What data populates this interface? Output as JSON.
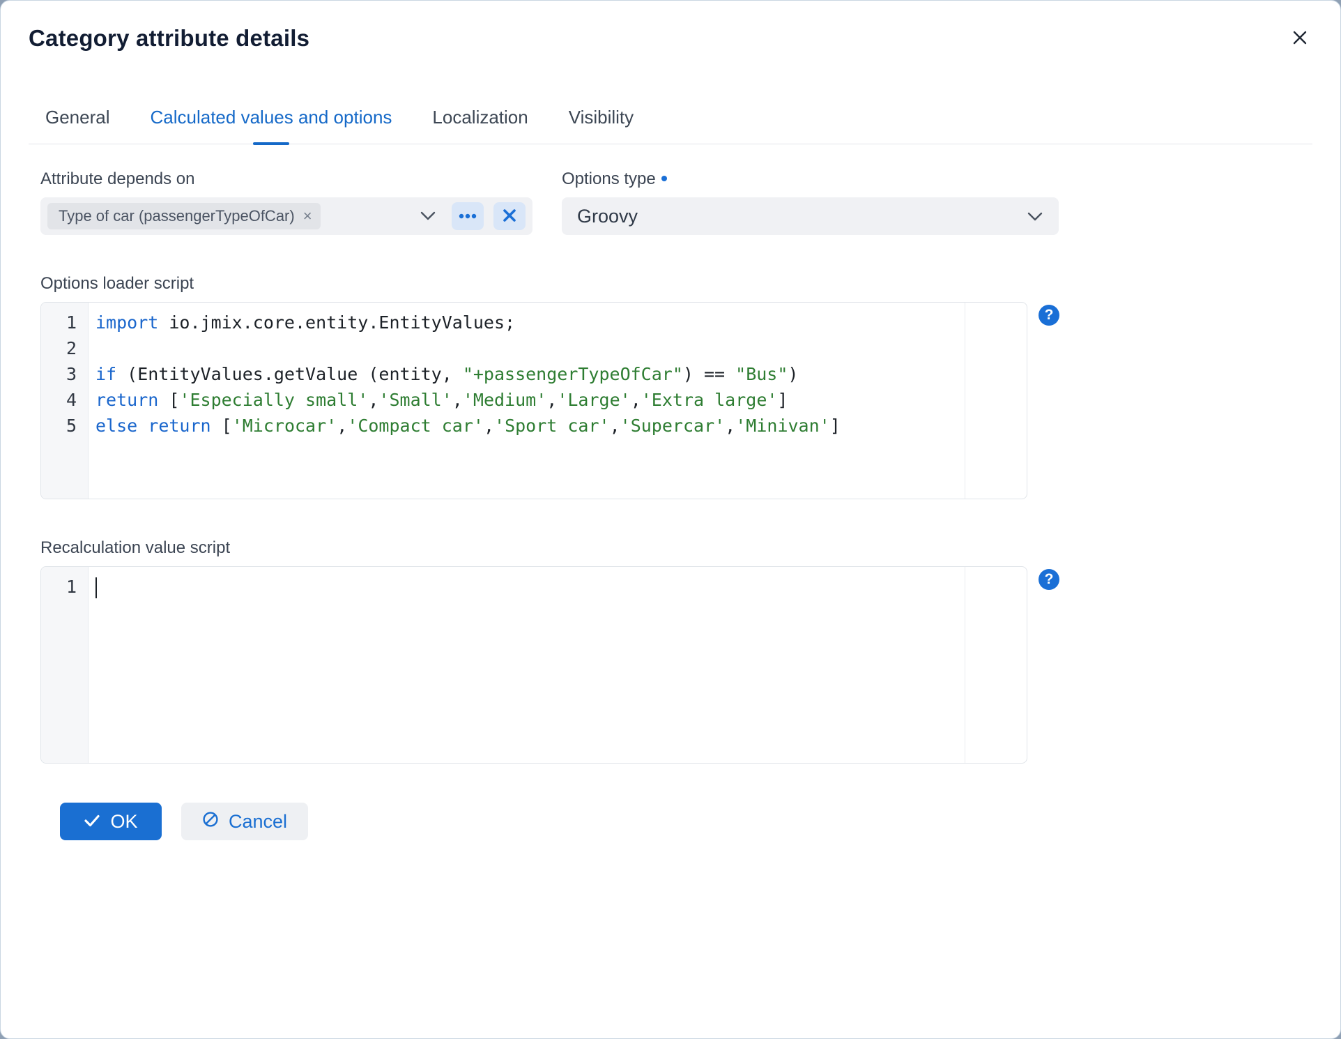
{
  "dialog": {
    "title": "Category attribute details"
  },
  "tabs": {
    "items": [
      {
        "label": "General",
        "active": false
      },
      {
        "label": "Calculated values and options",
        "active": true
      },
      {
        "label": "Localization",
        "active": false
      },
      {
        "label": "Visibility",
        "active": false
      }
    ]
  },
  "fields": {
    "attribute_depends_on": {
      "label": "Attribute depends on",
      "chip_label": "Type of car (passengerTypeOfCar)",
      "chip_remove_icon": "×"
    },
    "options_type": {
      "label": "Options type",
      "value": "Groovy"
    }
  },
  "editors": [
    {
      "id": "options-loader-script",
      "label": "Options loader script",
      "line_numbers": [
        "1",
        "2",
        "3",
        "4",
        "5"
      ],
      "show_cursor": false,
      "lines": [
        [
          {
            "text": "import",
            "type": "keyword"
          },
          {
            "text": " io.jmix.core.entity.EntityValues;",
            "type": "plain"
          }
        ],
        [],
        [
          {
            "text": "if",
            "type": "keyword"
          },
          {
            "text": " (EntityValues.getValue (entity, ",
            "type": "plain"
          },
          {
            "text": "\"+passengerTypeOfCar\"",
            "type": "string"
          },
          {
            "text": ") == ",
            "type": "plain"
          },
          {
            "text": "\"Bus\"",
            "type": "string"
          },
          {
            "text": ")",
            "type": "plain"
          }
        ],
        [
          {
            "text": "return",
            "type": "keyword"
          },
          {
            "text": " [",
            "type": "plain"
          },
          {
            "text": "'Especially small'",
            "type": "string"
          },
          {
            "text": ",",
            "type": "plain"
          },
          {
            "text": "'Small'",
            "type": "string"
          },
          {
            "text": ",",
            "type": "plain"
          },
          {
            "text": "'Medium'",
            "type": "string"
          },
          {
            "text": ",",
            "type": "plain"
          },
          {
            "text": "'Large'",
            "type": "string"
          },
          {
            "text": ",",
            "type": "plain"
          },
          {
            "text": "'Extra large'",
            "type": "string"
          },
          {
            "text": "]",
            "type": "plain"
          }
        ],
        [
          {
            "text": "else",
            "type": "keyword"
          },
          {
            "text": " ",
            "type": "plain"
          },
          {
            "text": "return",
            "type": "keyword"
          },
          {
            "text": " [",
            "type": "plain"
          },
          {
            "text": "'Microcar'",
            "type": "string"
          },
          {
            "text": ",",
            "type": "plain"
          },
          {
            "text": "'Compact car'",
            "type": "string"
          },
          {
            "text": ",",
            "type": "plain"
          },
          {
            "text": "'Sport car'",
            "type": "string"
          },
          {
            "text": ",",
            "type": "plain"
          },
          {
            "text": "'Supercar'",
            "type": "string"
          },
          {
            "text": ",",
            "type": "plain"
          },
          {
            "text": "'Minivan'",
            "type": "string"
          },
          {
            "text": "]",
            "type": "plain"
          }
        ]
      ]
    },
    {
      "id": "recalculation-value-script",
      "label": "Recalculation value script",
      "line_numbers": [
        "1"
      ],
      "show_cursor": true,
      "lines": [
        []
      ]
    }
  ],
  "help_icon": "?",
  "buttons": {
    "ok": "OK",
    "cancel": "Cancel"
  },
  "colors": {
    "primary": "#1a6fd2",
    "tab_active": "#1569c8",
    "code_keyword": "#1a66cc",
    "code_string": "#2e7d32"
  }
}
